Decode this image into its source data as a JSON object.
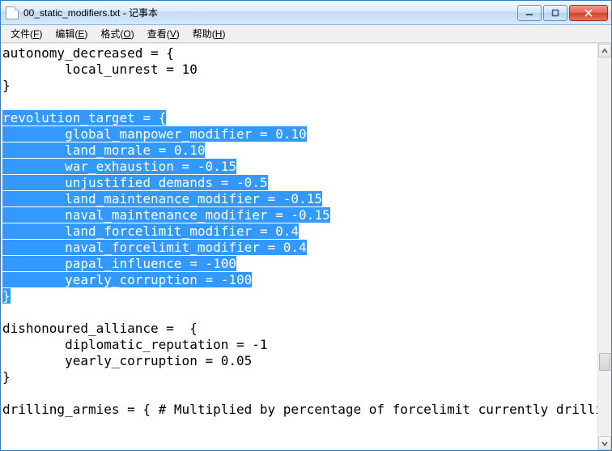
{
  "window": {
    "title": "00_static_modifiers.txt - 记事本"
  },
  "menu": {
    "file": {
      "label": "文件",
      "hotkey": "F"
    },
    "edit": {
      "label": "编辑",
      "hotkey": "E"
    },
    "format": {
      "label": "格式",
      "hotkey": "O"
    },
    "view": {
      "label": "查看",
      "hotkey": "V"
    },
    "help": {
      "label": "帮助",
      "hotkey": "H"
    }
  },
  "editor": {
    "lines": [
      {
        "text": "autonomy_decreased = {",
        "selected": false
      },
      {
        "text": "        local_unrest = 10",
        "selected": false
      },
      {
        "text": "}",
        "selected": false
      },
      {
        "text": "",
        "selected": false
      },
      {
        "text": "revolution_target = {",
        "selected": true
      },
      {
        "text": "        global_manpower_modifier = 0.10",
        "selected": true
      },
      {
        "text": "        land_morale = 0.10",
        "selected": true
      },
      {
        "text": "        war_exhaustion = -0.15",
        "selected": true
      },
      {
        "text": "        unjustified_demands = -0.5",
        "selected": true
      },
      {
        "text": "        land_maintenance_modifier = -0.15",
        "selected": true
      },
      {
        "text": "        naval_maintenance_modifier = -0.15",
        "selected": true
      },
      {
        "text": "        land_forcelimit_modifier = 0.4",
        "selected": true
      },
      {
        "text": "        naval_forcelimit_modifier = 0.4",
        "selected": true
      },
      {
        "text": "        papal_influence = -100",
        "selected": true
      },
      {
        "text": "        yearly_corruption = -100",
        "selected": true
      },
      {
        "text": "}",
        "selected": true
      },
      {
        "text": "",
        "selected": false
      },
      {
        "text": "dishonoured_alliance =  {",
        "selected": false
      },
      {
        "text": "        diplomatic_reputation = -1",
        "selected": false
      },
      {
        "text": "        yearly_corruption = 0.05",
        "selected": false
      },
      {
        "text": "}",
        "selected": false
      },
      {
        "text": "",
        "selected": false
      },
      {
        "text": "drilling_armies = { # Multiplied by percentage of forcelimit currently drilling",
        "selected": false
      }
    ]
  }
}
